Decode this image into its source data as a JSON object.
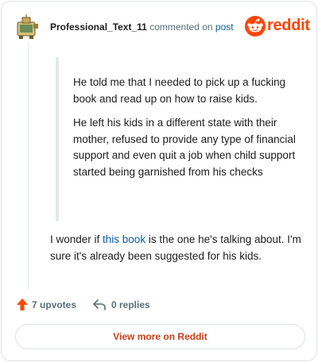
{
  "header": {
    "username": "Professional_Text_11",
    "action_text": "commented on",
    "post_link": "post",
    "brand": "reddit"
  },
  "comment": {
    "quote": [
      "He told me that I needed to pick up a fucking book and read up on how to raise kids.",
      "He left his kids in a different state with their mother, refused to provide any type of financial support and even quit a job when child support started being garnished from his checks"
    ],
    "body_before": "I wonder if ",
    "body_link": "this book",
    "body_after": " is the one he's talking about. I'm sure it's already been suggested for his kids."
  },
  "actions": {
    "upvotes": "7 upvotes",
    "replies": "0 replies"
  },
  "footer": {
    "view_more": "View more on Reddit"
  },
  "colors": {
    "brand": "#ff4500",
    "link": "#0a5fa6",
    "view_more": "#ca3e16"
  },
  "icons": [
    "avatar-icon",
    "reddit-logo-icon",
    "upvote-arrow-icon",
    "reply-arrow-icon"
  ]
}
